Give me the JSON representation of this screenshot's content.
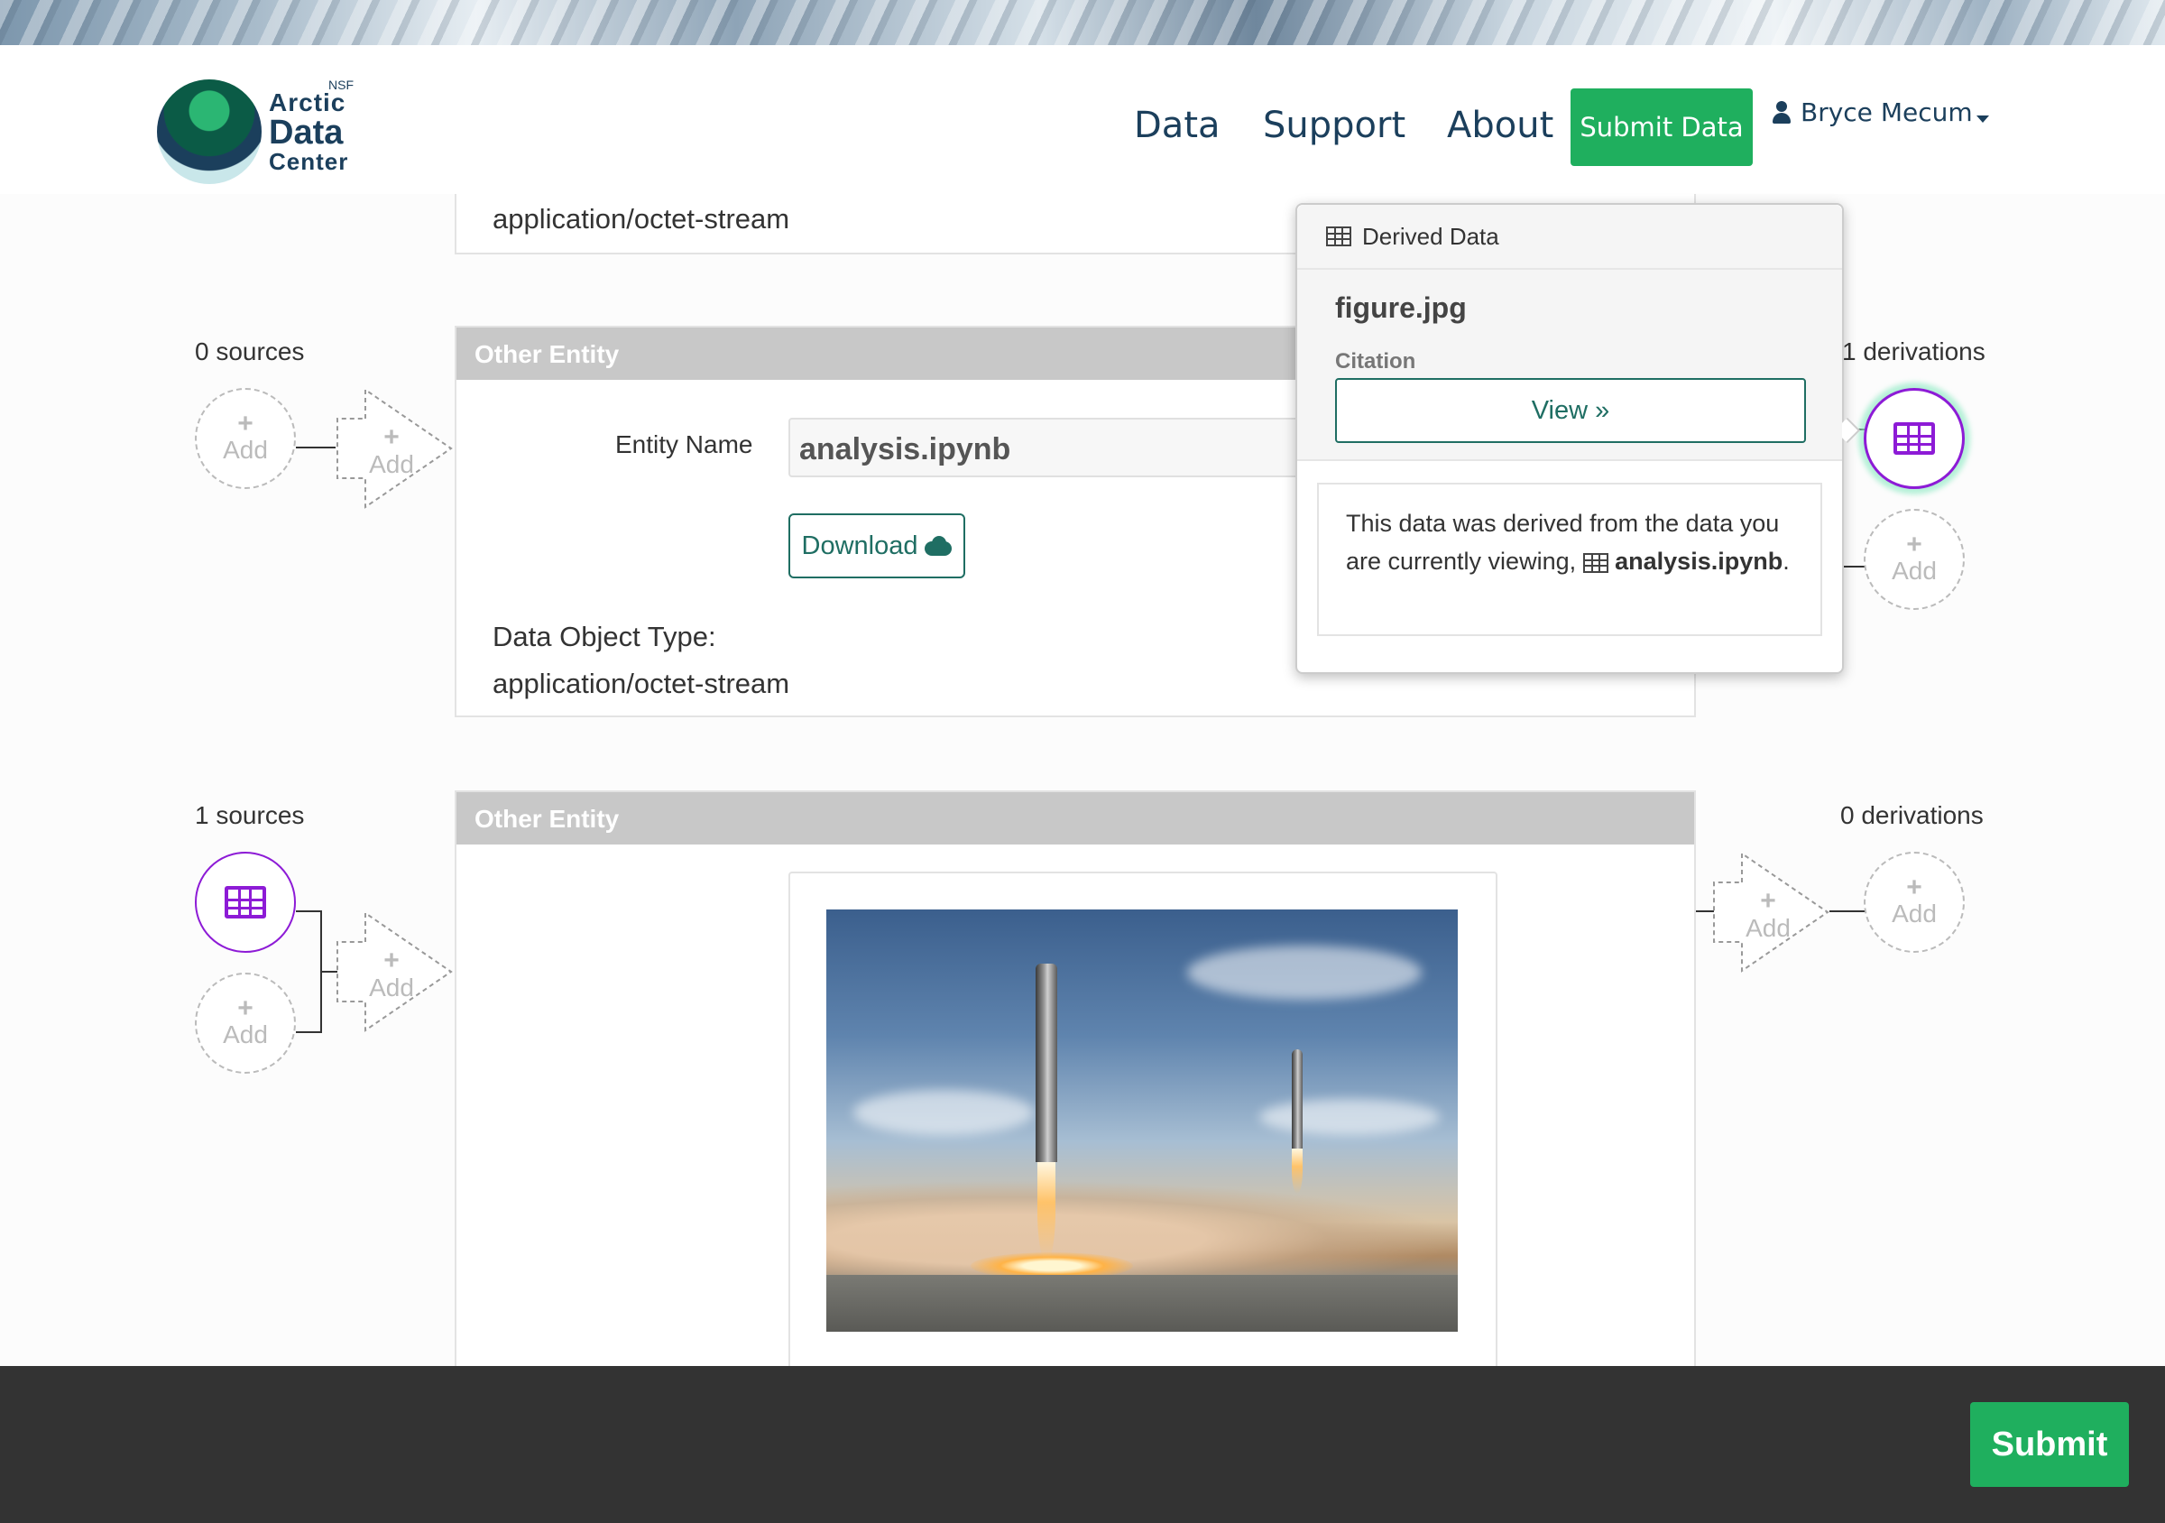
{
  "header": {
    "logo": {
      "nsf": "NSF",
      "line1": "Arctic",
      "line2": "Data",
      "line3": "Center"
    },
    "nav": {
      "data": "Data",
      "support": "Support",
      "about": "About"
    },
    "submit_data": "Submit Data",
    "user_name": "Bryce Mecum"
  },
  "top_panel": {
    "mime": "application/octet-stream"
  },
  "middle": {
    "sources_count": "0 sources",
    "derivations_count": "1 derivations",
    "panel_title": "Other Entity",
    "entity_name_label": "Entity Name",
    "entity_name_value": "analysis.ipynb",
    "download_label": "Download",
    "data_object_type_label": "Data Object Type:",
    "data_object_type_value": "application/octet-stream"
  },
  "bottom": {
    "sources_count": "1 sources",
    "derivations_count": "0 derivations",
    "panel_title": "Other Entity"
  },
  "nodes": {
    "add_label": "Add",
    "plus": "+"
  },
  "popover": {
    "header": "Derived Data",
    "title": "figure.jpg",
    "citation_label": "Citation",
    "view_label": "View »",
    "note_prefix": "This data was derived from the data you are currently viewing,",
    "note_entity": "analysis.ipynb",
    "note_suffix": "."
  },
  "footer": {
    "submit": "Submit"
  },
  "colors": {
    "accent_green": "#1faf5e",
    "teal": "#1f6e63",
    "purple": "#8d1bd6",
    "footer_bg": "#333333"
  },
  "icons": [
    "user-icon",
    "cloud-download-icon",
    "table-icon",
    "plus-icon",
    "double-chevron-right-icon"
  ]
}
